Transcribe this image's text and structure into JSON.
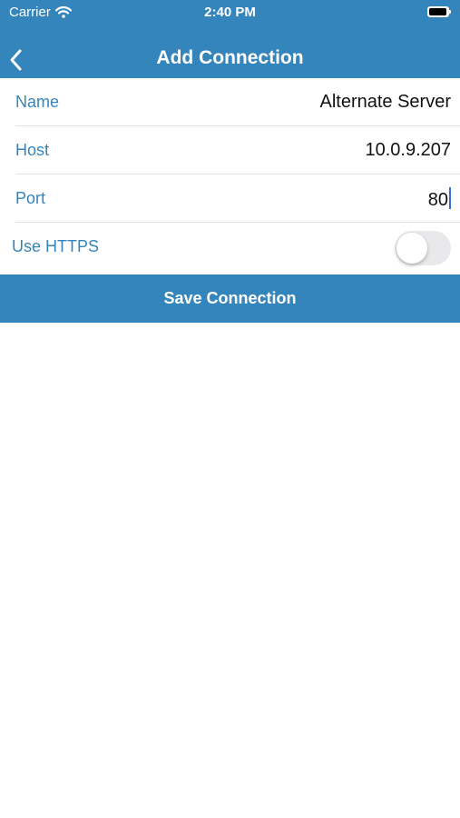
{
  "status_bar": {
    "carrier": "Carrier",
    "time": "2:40 PM"
  },
  "header": {
    "title": "Add Connection",
    "back_icon": "chevron-left"
  },
  "form": {
    "name": {
      "label": "Name",
      "value": "Alternate Server"
    },
    "host": {
      "label": "Host",
      "value": "10.0.9.207"
    },
    "port": {
      "label": "Port",
      "value": "80"
    },
    "use_https": {
      "label": "Use HTTPS",
      "enabled": false
    }
  },
  "actions": {
    "save_label": "Save Connection"
  },
  "colors": {
    "accent": "#3585bd",
    "toggle_off": "#e9e9eb"
  }
}
